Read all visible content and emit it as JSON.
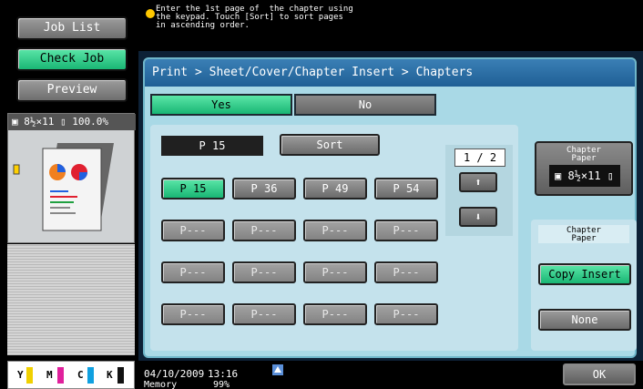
{
  "sidebar": {
    "job_list": "Job List",
    "check_job": "Check Job",
    "preview": "Preview",
    "preview_info": "▣ 8½×11 ▯  100.0%",
    "toner": [
      "Y",
      "M",
      "C",
      "K"
    ],
    "toner_colors": [
      "#f0d000",
      "#e0209c",
      "#10a0e0",
      "#111111"
    ]
  },
  "message": {
    "text": "Enter the 1st page of  the chapter using\nthe keypad. Touch [Sort] to sort pages\nin ascending order."
  },
  "breadcrumb": "Print > Sheet/Cover/Chapter Insert > Chapters",
  "toggle": {
    "yes": "Yes",
    "no": "No"
  },
  "input": {
    "value": "P 15",
    "sort": "Sort"
  },
  "pages": [
    "P 15",
    "P 36",
    "P 49",
    "P 54",
    "P---",
    "P---",
    "P---",
    "P---",
    "P---",
    "P---",
    "P---",
    "P---",
    "P---",
    "P---",
    "P---",
    "P---"
  ],
  "pager": {
    "count": "1 / 2",
    "up": "⬆",
    "down": "⬇"
  },
  "chapter_paper": {
    "label": "Chapter\nPaper",
    "value": "▣ 8½×11 ▯"
  },
  "right_panel": {
    "title": "Chapter\nPaper",
    "copy_insert": "Copy Insert",
    "none": "None"
  },
  "status": {
    "date": "04/10/2009",
    "time": "13:16",
    "memory": "Memory",
    "memory_pct": "99%"
  },
  "ok": "OK",
  "colors": {
    "accent_green": "#19b674",
    "panel_bg": "#a9d9e6",
    "header_blue": "#1f5f95"
  }
}
